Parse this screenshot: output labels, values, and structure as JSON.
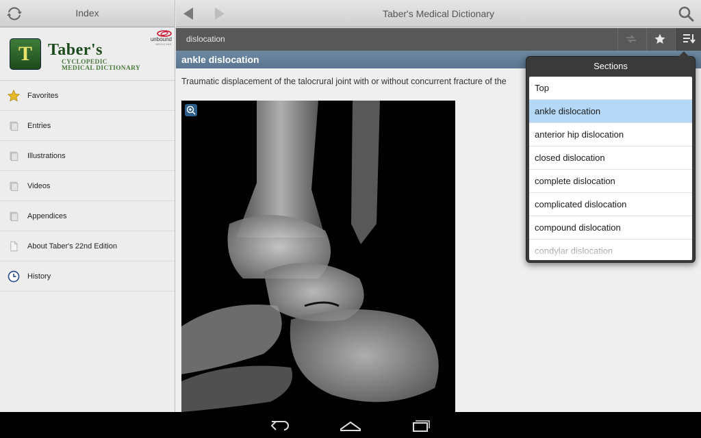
{
  "left_pane": {
    "title": "Index",
    "logo": {
      "letter": "T",
      "title": "Taber's",
      "subtitle_line1": "CYCLOPEDIC",
      "subtitle_line2": "MEDICAL DICTIONARY",
      "publisher": "unbound",
      "publisher_sub": "MEDICINE"
    },
    "nav_items": [
      {
        "label": "Favorites",
        "icon": "star-icon"
      },
      {
        "label": "Entries",
        "icon": "page-icon"
      },
      {
        "label": "Illustrations",
        "icon": "page-icon"
      },
      {
        "label": "Videos",
        "icon": "page-icon"
      },
      {
        "label": "Appendices",
        "icon": "page-icon"
      },
      {
        "label": "About Taber's 22nd Edition",
        "icon": "document-icon"
      },
      {
        "label": "History",
        "icon": "clock-icon"
      }
    ]
  },
  "header": {
    "title": "Taber's Medical Dictionary"
  },
  "entry": {
    "title": "dislocation",
    "section_title": "ankle dislocation",
    "definition": "Traumatic displacement of the talocrural joint with or without concurrent fracture of the"
  },
  "sections_popup": {
    "title": "Sections",
    "items": [
      {
        "label": "Top"
      },
      {
        "label": "ankle dislocation",
        "selected": true
      },
      {
        "label": "anterior hip dislocation"
      },
      {
        "label": "closed dislocation"
      },
      {
        "label": "complete dislocation"
      },
      {
        "label": "complicated dislocation"
      },
      {
        "label": "compound dislocation"
      },
      {
        "label": "condylar dislocation"
      }
    ]
  },
  "colors": {
    "section_bar": "#6580a0",
    "selected_item": "#b5d8f6",
    "subheader": "#585858"
  }
}
